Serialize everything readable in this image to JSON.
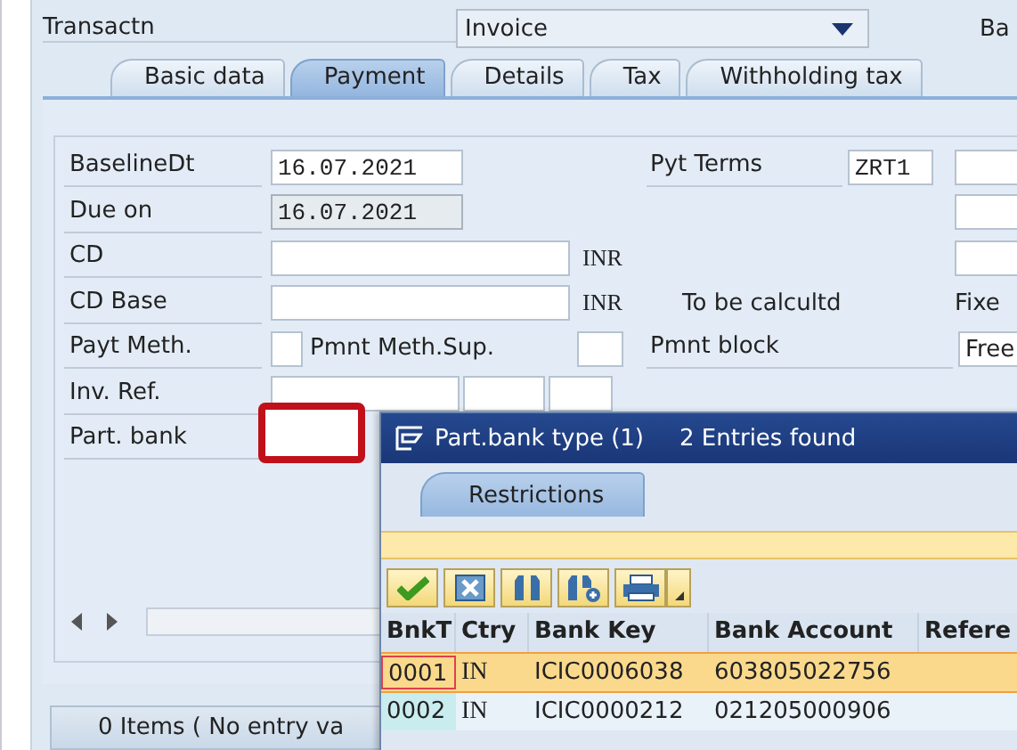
{
  "header": {
    "transaction_label": "Transactn",
    "transaction_value": "Invoice",
    "cut_label": "Ba"
  },
  "tabs": [
    {
      "label": "Basic data",
      "selected": false
    },
    {
      "label": "Payment",
      "selected": true
    },
    {
      "label": "Details",
      "selected": false
    },
    {
      "label": "Tax",
      "selected": false
    },
    {
      "label": "Withholding tax",
      "selected": false
    }
  ],
  "form": {
    "baseline": {
      "label": "BaselineDt",
      "value": "16.07.2021",
      "readonly": false
    },
    "due_on": {
      "label": "Due on",
      "value": "16.07.2021",
      "readonly": true
    },
    "cd": {
      "label": "CD",
      "currency": "INR"
    },
    "cd_base": {
      "label": "CD Base",
      "currency": "INR",
      "note": "To be calcultd"
    },
    "payt_meth": {
      "label": "Payt Meth.",
      "sup_label": "Pmnt Meth.Sup."
    },
    "inv_ref": {
      "label": "Inv. Ref."
    },
    "part_bank": {
      "label": "Part. bank",
      "highlighted": true
    },
    "pyt_terms": {
      "label": "Pyt Terms",
      "value": "ZRT1"
    },
    "fixed_label": "Fixe",
    "pmnt_block": {
      "label": "Pmnt block",
      "value": "Free"
    }
  },
  "status_bar": {
    "text": "0 Items ( No entry va"
  },
  "popup": {
    "title": "Part.bank type (1)",
    "count": "2 Entries found",
    "tab": "Restrictions",
    "columns": [
      "BnkT",
      "Ctry",
      "Bank Key",
      "Bank Account",
      "Refere"
    ],
    "rows": [
      {
        "cells": [
          "0001",
          "IN",
          "ICIC0006038",
          "603805022756"
        ],
        "selected": true
      },
      {
        "cells": [
          "0002",
          "IN",
          "ICIC0000212",
          "021205000906"
        ],
        "selected": false
      }
    ]
  }
}
